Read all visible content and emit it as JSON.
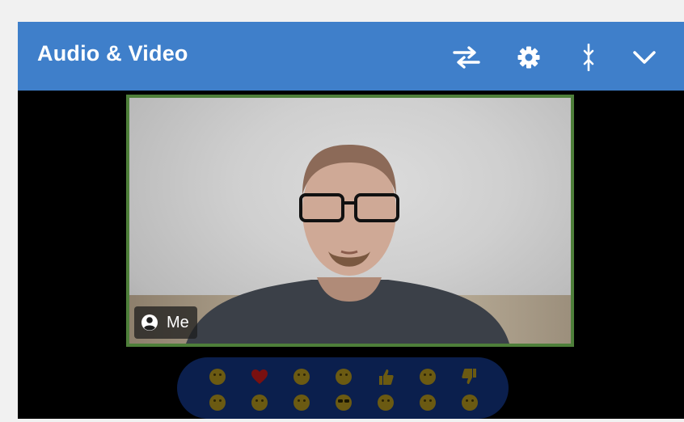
{
  "window": {
    "title": "Audio & Video"
  },
  "header_buttons": [
    {
      "name": "switch-layout-button",
      "icon": "swap-arrows-icon"
    },
    {
      "name": "settings-button",
      "icon": "gear-icon"
    },
    {
      "name": "resize-button",
      "icon": "vertical-resize-icon"
    },
    {
      "name": "collapse-button",
      "icon": "chevron-down-icon"
    }
  ],
  "video": {
    "participant_name": "Me",
    "participant_icon": "user-circle-icon",
    "border_color": "#4e7f3a"
  },
  "reactions": {
    "row1": [
      "smile",
      "heart",
      "grin",
      "surprised",
      "thumbs-up",
      "sad",
      "thumbs-down"
    ],
    "row2": [
      "slight-smile",
      "blush",
      "neutral-smile",
      "sunglasses",
      "thinking",
      "expressionless",
      "astonished"
    ]
  },
  "colors": {
    "header_bg": "#3f7fca",
    "reaction_bar_bg": "#0b1f4d",
    "panel_bg": "#000000"
  }
}
